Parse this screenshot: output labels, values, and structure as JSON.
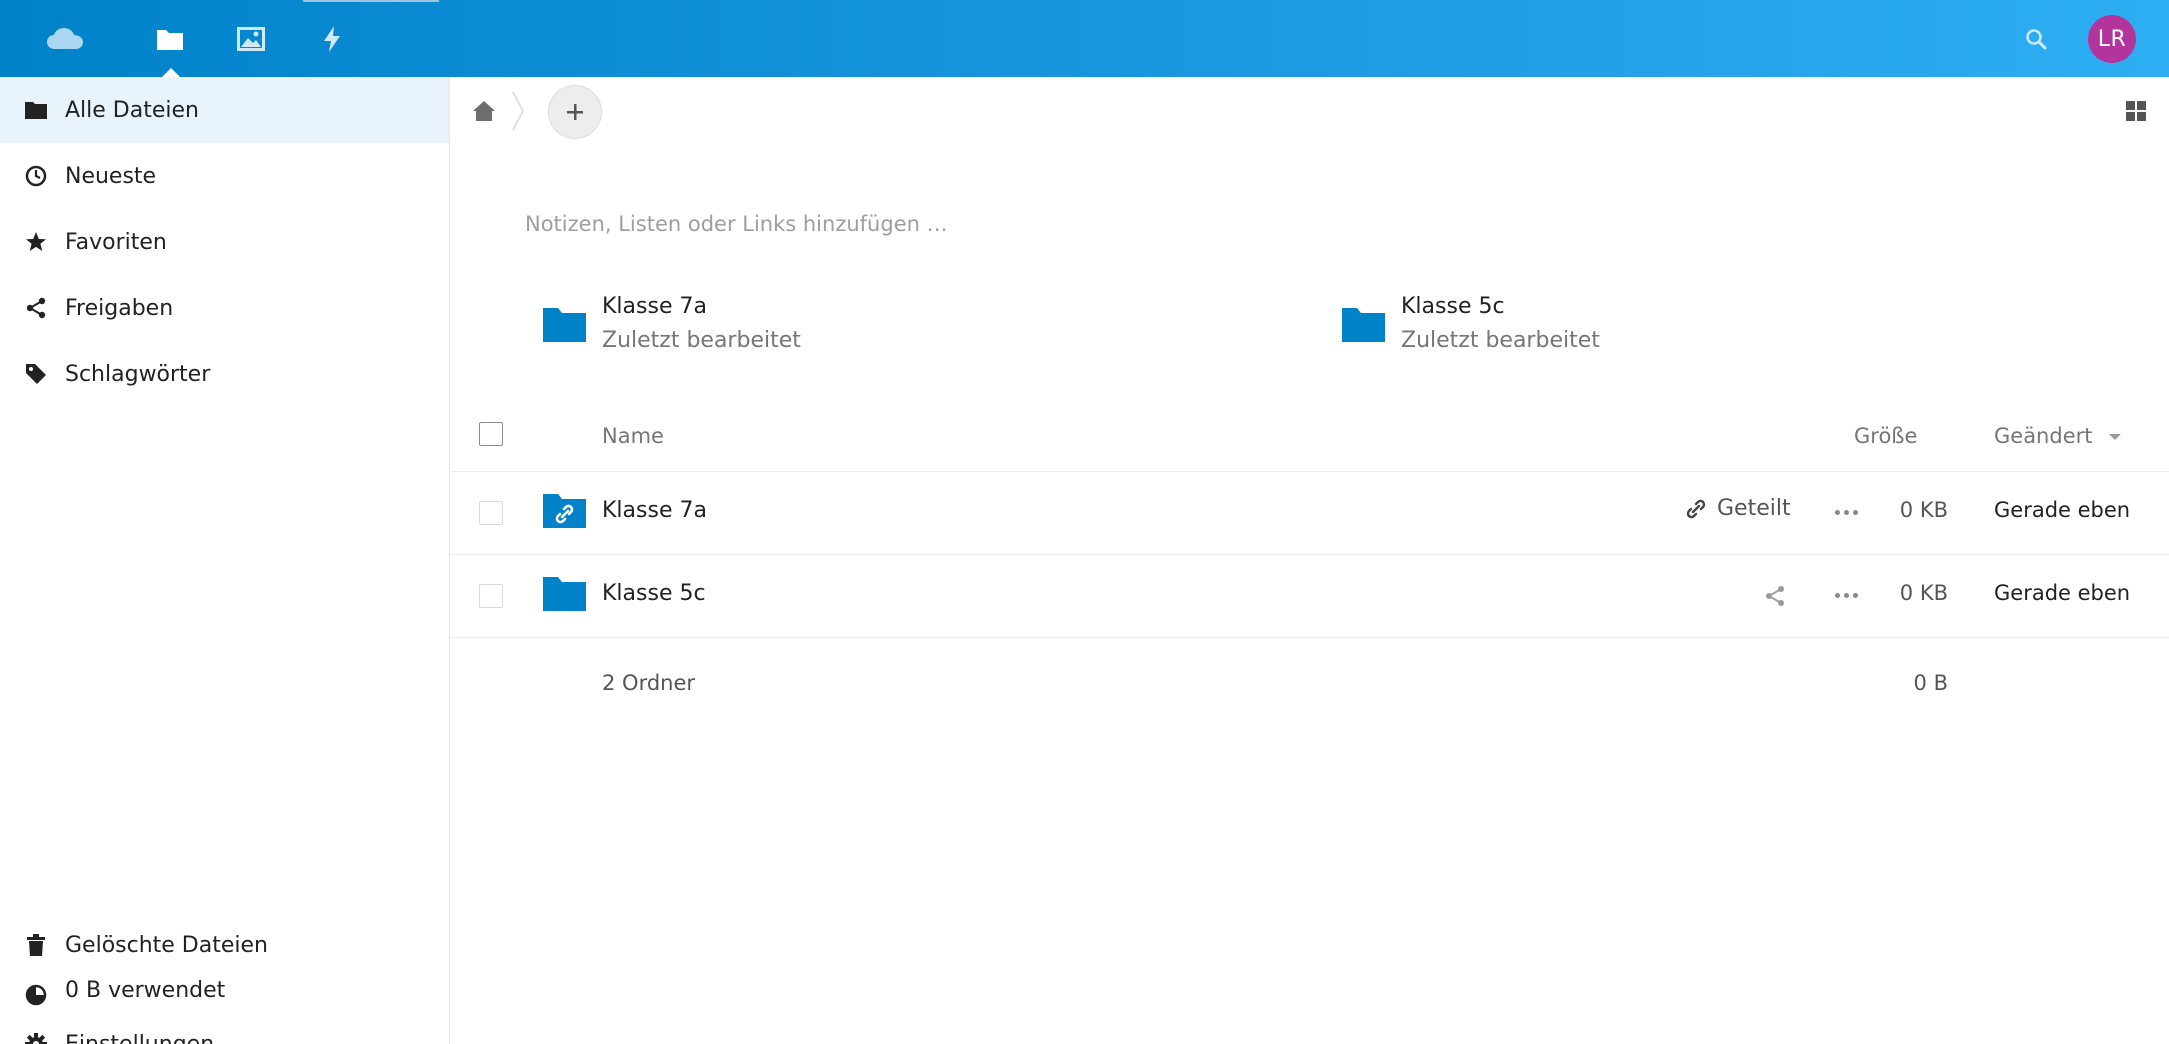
{
  "header": {
    "apps": [
      {
        "name": "files",
        "icon": "folder-icon",
        "active": true
      },
      {
        "name": "photos",
        "icon": "image-icon",
        "active": false
      },
      {
        "name": "activity",
        "icon": "lightning-icon",
        "active": false
      }
    ],
    "avatar_initials": "LR",
    "avatar_color": "#b3359c",
    "accent_color": "#0082c9"
  },
  "sidebar": {
    "items": [
      {
        "label": "Alle Dateien",
        "icon": "folder-icon",
        "active": true
      },
      {
        "label": "Neueste",
        "icon": "clock-icon",
        "active": false
      },
      {
        "label": "Favoriten",
        "icon": "star-icon",
        "active": false
      },
      {
        "label": "Freigaben",
        "icon": "share-icon",
        "active": false
      },
      {
        "label": "Schlagwörter",
        "icon": "tag-icon",
        "active": false
      }
    ],
    "bottom": {
      "trash_label": "Gelöschte Dateien",
      "quota_label": "0 B verwendet",
      "settings_label": "Einstellungen"
    }
  },
  "main": {
    "rich_workspace_placeholder": "Notizen, Listen oder Links hinzufügen …",
    "recent": [
      {
        "title": "Klasse 7a",
        "subtitle": "Zuletzt bearbeitet"
      },
      {
        "title": "Klasse 5c",
        "subtitle": "Zuletzt bearbeitet"
      }
    ],
    "columns": {
      "name": "Name",
      "size": "Größe",
      "modified": "Geändert"
    },
    "files": [
      {
        "name": "Klasse 7a",
        "share_label": "Geteilt",
        "shared": true,
        "size": "0 KB",
        "modified": "Gerade eben"
      },
      {
        "name": "Klasse 5c",
        "share_label": "",
        "shared": false,
        "size": "0 KB",
        "modified": "Gerade eben"
      }
    ],
    "summary": {
      "count": "2 Ordner",
      "size": "0 B"
    }
  }
}
